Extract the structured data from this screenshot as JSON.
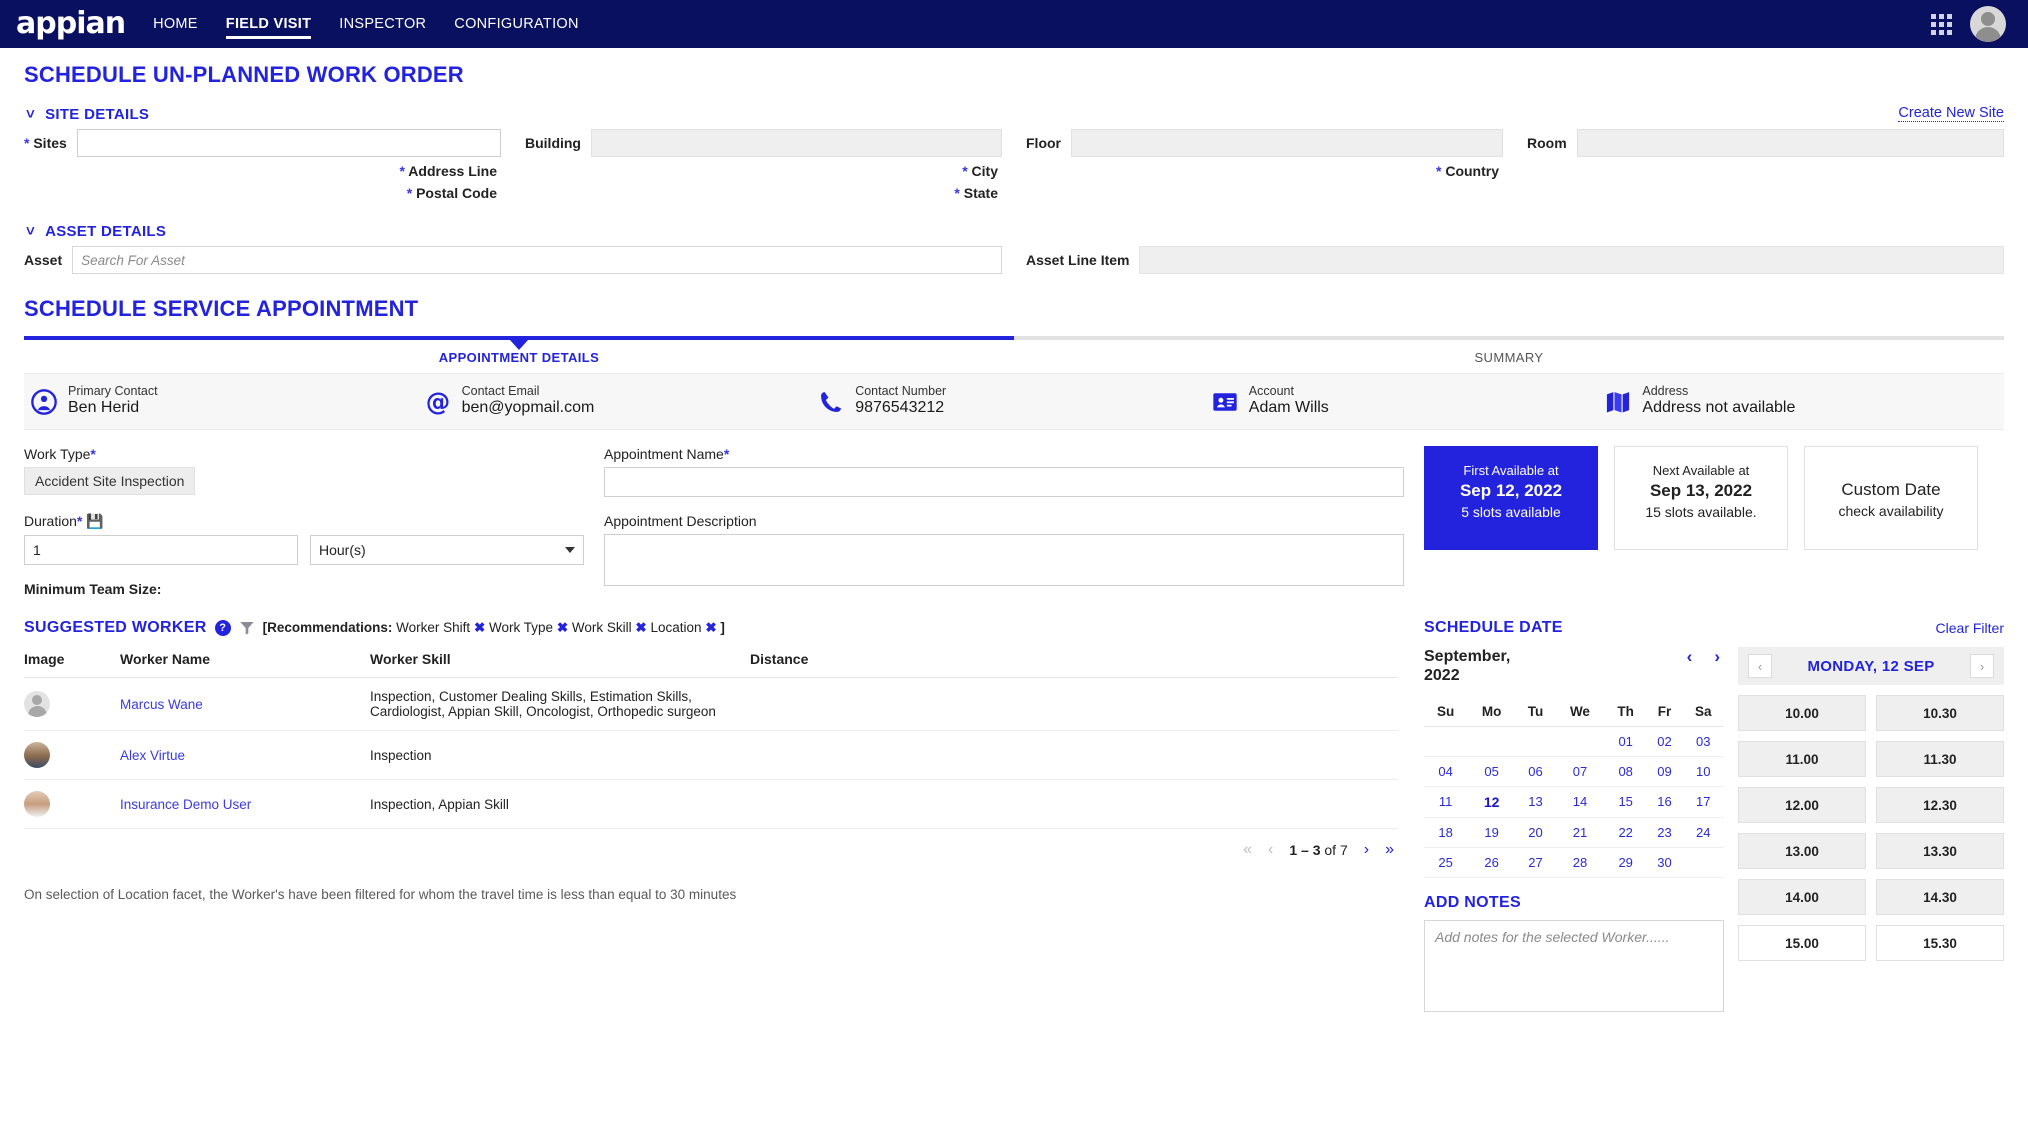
{
  "nav": {
    "logo": "appian",
    "items": [
      {
        "label": "HOME",
        "active": false
      },
      {
        "label": "FIELD VISIT",
        "active": true
      },
      {
        "label": "INSPECTOR",
        "active": false
      },
      {
        "label": "CONFIGURATION",
        "active": false
      }
    ],
    "apps_icon": "grid-icon",
    "avatar_icon": "avatar"
  },
  "page": {
    "title": "SCHEDULE UN-PLANNED WORK ORDER"
  },
  "site_details": {
    "header": "SITE DETAILS",
    "create_link": "Create New Site",
    "fields": [
      {
        "label": "Sites",
        "required": true,
        "readonly": false,
        "value": ""
      },
      {
        "label": "Building",
        "required": false,
        "readonly": true,
        "value": ""
      },
      {
        "label": "Floor",
        "required": false,
        "readonly": true,
        "value": ""
      },
      {
        "label": "Room",
        "required": false,
        "readonly": true,
        "value": ""
      }
    ],
    "labels_row2": [
      {
        "label": "Address Line",
        "required": true
      },
      {
        "label": "City",
        "required": true
      },
      {
        "label": "Country",
        "required": true
      },
      {
        "label": "",
        "required": false
      }
    ],
    "labels_row3": [
      {
        "label": "Postal Code",
        "required": true
      },
      {
        "label": "State",
        "required": true
      },
      {
        "label": "",
        "required": false
      },
      {
        "label": "",
        "required": false
      }
    ]
  },
  "asset_details": {
    "header": "ASSET DETAILS",
    "asset_label": "Asset",
    "asset_placeholder": "Search For Asset",
    "asset_line_label": "Asset Line Item",
    "asset_line_value": ""
  },
  "appointment": {
    "title": "SCHEDULE SERVICE APPOINTMENT",
    "tabs": [
      {
        "label": "APPOINTMENT DETAILS",
        "active": true
      },
      {
        "label": "SUMMARY",
        "active": false
      }
    ],
    "contacts": [
      {
        "icon": "person-icon",
        "key": "Primary Contact",
        "value": "Ben Herid"
      },
      {
        "icon": "at-icon",
        "key": "Contact Email",
        "value": "ben@yopmail.com"
      },
      {
        "icon": "phone-icon",
        "key": "Contact Number",
        "value": "9876543212"
      },
      {
        "icon": "id-card-icon",
        "key": "Account",
        "value": "Adam Wills"
      },
      {
        "icon": "map-icon",
        "key": "Address",
        "value": "Address not available"
      }
    ],
    "work_type_label": "Work Type",
    "work_type_value": "Accident Site Inspection",
    "duration_label": "Duration",
    "duration_value": "1",
    "duration_unit": "Hour(s)",
    "min_team_label": "Minimum Team Size:",
    "appointment_name_label": "Appointment Name",
    "appointment_name_value": "",
    "appointment_desc_label": "Appointment Description",
    "appointment_desc_value": "",
    "availability": [
      {
        "top": "First Available at",
        "date": "Sep 12, 2022",
        "slots": "5 slots available",
        "selected": true
      },
      {
        "top": "Next Available at",
        "date": "Sep 13, 2022",
        "slots": "15 slots available.",
        "selected": false
      },
      {
        "top": "",
        "date": "Custom Date",
        "slots": "check availability",
        "selected": false
      }
    ]
  },
  "suggested_worker": {
    "title": "SUGGESTED WORKER",
    "recommendations_label": "Recommendations:",
    "bracket_open": "[",
    "bracket_close": "]",
    "facets": [
      "Worker Shift",
      "Work Type",
      "Work Skill",
      "Location"
    ],
    "columns": [
      "Image",
      "Worker Name",
      "Worker Skill",
      "Distance"
    ],
    "rows": [
      {
        "avatar": "avatar-generic",
        "name": "Marcus Wane",
        "skill": "Inspection, Customer Dealing Skills, Estimation Skills, Cardiologist, Appian Skill, Oncologist, Orthopedic surgeon",
        "distance": ""
      },
      {
        "avatar": "avatar-photo-1",
        "name": "Alex Virtue",
        "skill": "Inspection",
        "distance": ""
      },
      {
        "avatar": "avatar-photo-2",
        "name": "Insurance Demo User",
        "skill": "Inspection, Appian Skill",
        "distance": ""
      }
    ],
    "pager": {
      "range": "1 – 3",
      "of": "of",
      "total": "7"
    },
    "footer_note": "On selection of Location facet, the Worker's have been filtered for whom the travel time is less than equal to 30 minutes"
  },
  "schedule_date": {
    "title": "SCHEDULE DATE",
    "clear_filter": "Clear Filter",
    "month": "September,",
    "year": "2022",
    "weekdays": [
      "Su",
      "Mo",
      "Tu",
      "We",
      "Th",
      "Fr",
      "Sa"
    ],
    "weeks": [
      [
        "",
        "",
        "",
        "",
        "01",
        "02",
        "03"
      ],
      [
        "04",
        "05",
        "06",
        "07",
        "08",
        "09",
        "10"
      ],
      [
        "11",
        "12",
        "13",
        "14",
        "15",
        "16",
        "17"
      ],
      [
        "18",
        "19",
        "20",
        "21",
        "22",
        "23",
        "24"
      ],
      [
        "25",
        "26",
        "27",
        "28",
        "29",
        "30",
        ""
      ]
    ],
    "selected_day": "12",
    "slot_day": "MONDAY, 12 SEP",
    "slots": [
      {
        "time": "10.00",
        "open": false
      },
      {
        "time": "10.30",
        "open": false
      },
      {
        "time": "11.00",
        "open": false
      },
      {
        "time": "11.30",
        "open": false
      },
      {
        "time": "12.00",
        "open": false
      },
      {
        "time": "12.30",
        "open": false
      },
      {
        "time": "13.00",
        "open": false
      },
      {
        "time": "13.30",
        "open": false
      },
      {
        "time": "14.00",
        "open": false
      },
      {
        "time": "14.30",
        "open": false
      },
      {
        "time": "15.00",
        "open": true
      },
      {
        "time": "15.30",
        "open": true
      }
    ],
    "notes_title": "ADD NOTES",
    "notes_placeholder": "Add notes for the selected Worker......"
  },
  "colors": {
    "navy": "#0a1060",
    "accent": "#2323dd",
    "readonly_bg": "#efefef"
  }
}
